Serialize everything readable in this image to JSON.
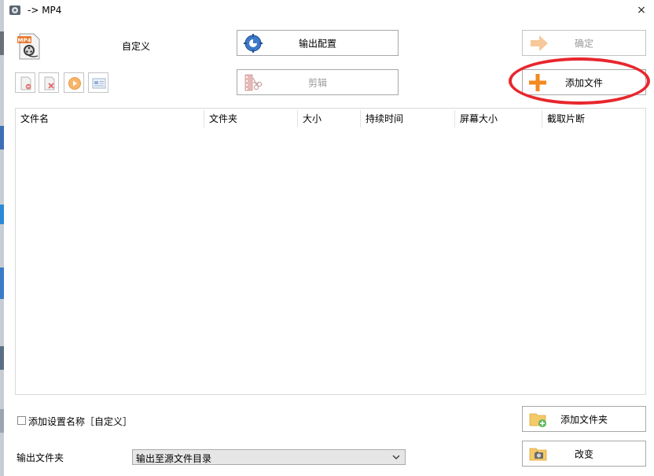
{
  "window": {
    "title": "-> MP4",
    "close_glyph": "×"
  },
  "profile": {
    "icon": "mp4-format-icon",
    "name": "自定义"
  },
  "buttons": {
    "output_config": "输出配置",
    "ok": "确定",
    "clip": "剪辑",
    "add_file": "添加文件",
    "add_folder": "添加文件夹",
    "change": "改变"
  },
  "toolbar": {
    "items": [
      "remove-item-icon",
      "clear-list-icon",
      "play-icon",
      "media-info-icon"
    ]
  },
  "file_list": {
    "columns": [
      "文件名",
      "文件夹",
      "大小",
      "持续时间",
      "屏幕大小",
      "截取片断"
    ],
    "rows": []
  },
  "options": {
    "add_setting_name_checked": false,
    "add_setting_name_label": "添加设置名称［自定义］"
  },
  "output": {
    "label": "输出文件夹",
    "selected": "输出至源文件目录"
  },
  "colors": {
    "highlight_ring": "#e8262d",
    "add_icon_orange": "#f28a1e",
    "disabled_text": "#9a9a9a"
  }
}
